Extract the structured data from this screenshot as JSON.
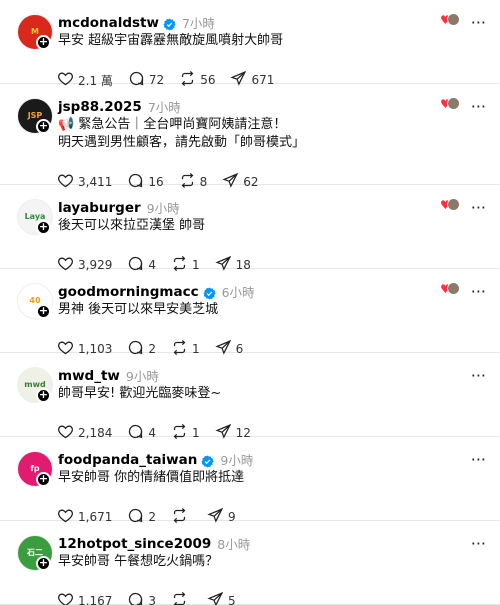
{
  "posts": [
    {
      "username": "mcdonaldstw",
      "verified": true,
      "time": "7小時",
      "lines": [
        "早安 超級宇宙霹靂無敵旋風噴射大帥哥"
      ],
      "likes": "2.1 萬",
      "comments": "72",
      "reposts": "56",
      "shares": "671",
      "reacted": true,
      "avatar": {
        "bg": "#da291c",
        "fg": "#ffc72c",
        "text": "M"
      }
    },
    {
      "username": "jsp88.2025",
      "verified": false,
      "time": "7小時",
      "lines": [
        "📢 緊急公告｜全台呷尚寶阿姨請注意！",
        "明天遇到男性顧客，請先啟動「帥哥模式」"
      ],
      "likes": "3,411",
      "comments": "16",
      "reposts": "8",
      "shares": "62",
      "reacted": true,
      "avatar": {
        "bg": "#1a1a1a",
        "fg": "#f5a623",
        "text": "JSP"
      }
    },
    {
      "username": "layaburger",
      "verified": false,
      "time": "9小時",
      "lines": [
        "後天可以來拉亞漢堡 帥哥"
      ],
      "likes": "3,929",
      "comments": "4",
      "reposts": "1",
      "shares": "18",
      "reacted": true,
      "avatar": {
        "bg": "#f4f4f4",
        "fg": "#2e8b3a",
        "text": "Laya"
      }
    },
    {
      "username": "goodmorningmacc",
      "verified": true,
      "time": "6小時",
      "lines": [
        "男神 後天可以來早安美芝城"
      ],
      "likes": "1,103",
      "comments": "2",
      "reposts": "1",
      "shares": "6",
      "reacted": true,
      "avatar": {
        "bg": "#ffffff",
        "fg": "#f39c12",
        "text": "40"
      }
    },
    {
      "username": "mwd_tw",
      "verified": false,
      "time": "9小時",
      "lines": [
        "帥哥早安! 歡迎光臨麥味登~"
      ],
      "likes": "2,184",
      "comments": "4",
      "reposts": "1",
      "shares": "12",
      "reacted": false,
      "avatar": {
        "bg": "#eef2e6",
        "fg": "#3d7a3a",
        "text": "mwd"
      }
    },
    {
      "username": "foodpanda_taiwan",
      "verified": true,
      "time": "9小時",
      "lines": [
        "早安帥哥 你的情緒價值即將抵達"
      ],
      "likes": "1,671",
      "comments": "2",
      "reposts": "",
      "shares": "9",
      "reacted": false,
      "avatar": {
        "bg": "#e21b70",
        "fg": "#ffffff",
        "text": "fp"
      }
    },
    {
      "username": "12hotpot_since2009",
      "verified": false,
      "time": "8小時",
      "lines": [
        "早安帥哥 午餐想吃火鍋嗎？"
      ],
      "likes": "1,167",
      "comments": "3",
      "reposts": "",
      "shares": "5",
      "reacted": false,
      "avatar": {
        "bg": "#3a9d3f",
        "fg": "#ffffff",
        "text": "石二"
      }
    }
  ],
  "colors": {
    "verified": "#0095f6",
    "heart": "#ff3040",
    "muted": "#999999"
  }
}
